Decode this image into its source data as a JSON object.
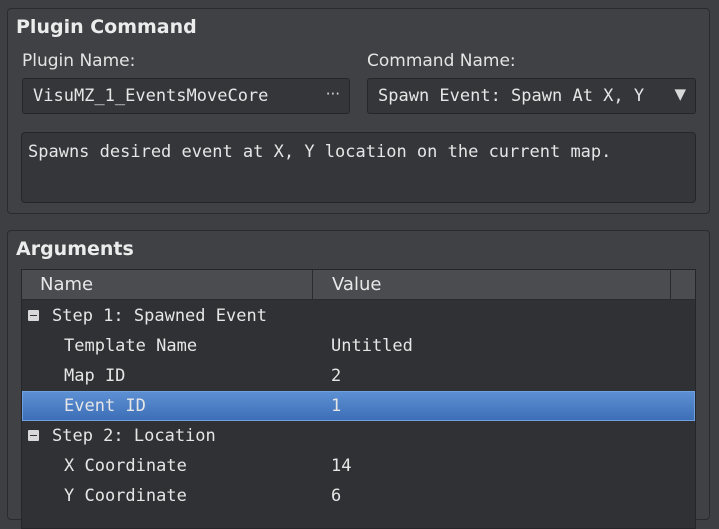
{
  "plugin_command": {
    "title": "Plugin Command",
    "plugin_name_label": "Plugin Name:",
    "plugin_name_value": "VisuMZ_1_EventsMoveCore",
    "plugin_name_button": "···",
    "command_name_label": "Command Name:",
    "command_name_value": "Spawn Event: Spawn At X, Y",
    "command_dropdown_arrow": "▼",
    "description": "Spawns desired event at X, Y location on the current map."
  },
  "arguments": {
    "title": "Arguments",
    "columns": [
      "Name",
      "Value"
    ],
    "rows": [
      {
        "name": "Step 1: Spawned Event",
        "value": "",
        "group": true
      },
      {
        "name": "Template Name",
        "value": "Untitled",
        "group": false
      },
      {
        "name": "Map ID",
        "value": "2",
        "group": false
      },
      {
        "name": "Event ID",
        "value": "1",
        "group": false,
        "selected": true
      },
      {
        "name": "Step 2: Location",
        "value": "",
        "group": true
      },
      {
        "name": "X Coordinate",
        "value": "14",
        "group": false
      },
      {
        "name": "Y Coordinate",
        "value": "6",
        "group": false
      }
    ]
  },
  "colors": {
    "background": "#3d3f42",
    "selection": "#4a7cc4"
  }
}
